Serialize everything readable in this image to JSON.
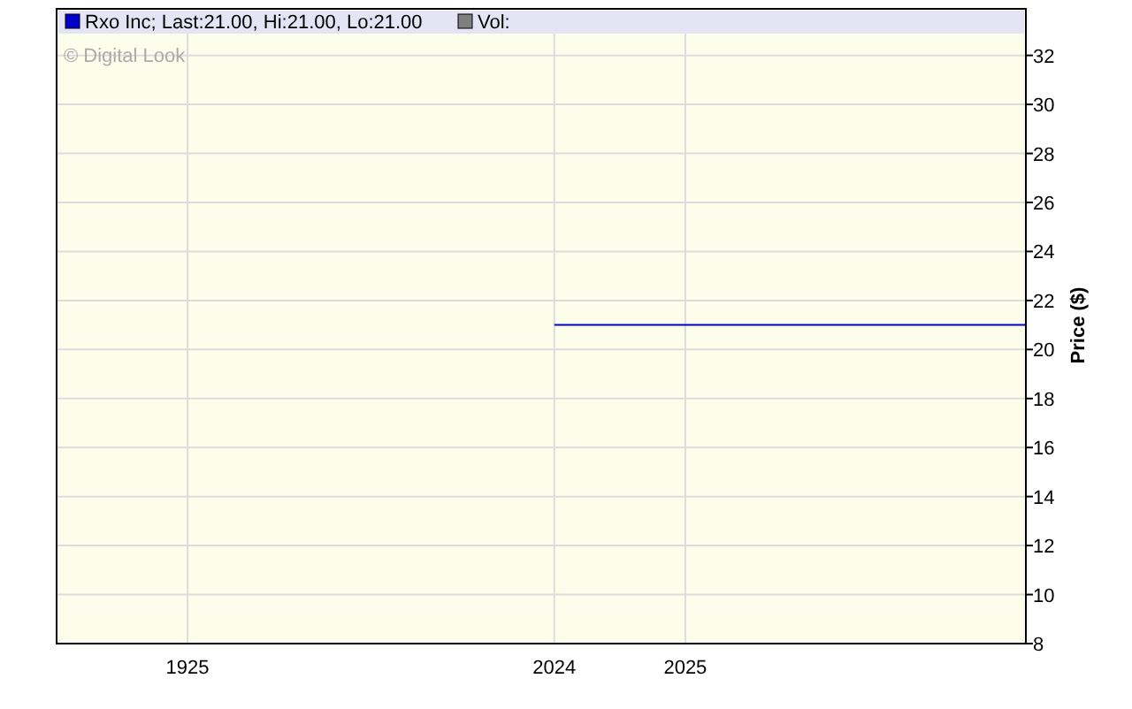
{
  "chart": {
    "legend": [
      {
        "label": "Rxo Inc; Last:21.00, Hi:21.00, Lo:21.00",
        "color": "#0000cc"
      },
      {
        "label": "Vol:",
        "color": "#808080"
      }
    ],
    "credit": "© Digital Look",
    "chart_data": {
      "type": "line",
      "ylabel": "Price ($)",
      "ylim": [
        8,
        33.9
      ],
      "grid": true,
      "categories": [
        null,
        null,
        null,
        null,
        null,
        "1925",
        null,
        null,
        null,
        null,
        null,
        null,
        null,
        null,
        null,
        null,
        null,
        null,
        null,
        "2024",
        null,
        null,
        null,
        null,
        "2025",
        null,
        null,
        null,
        null,
        null,
        null,
        null,
        null,
        null,
        null,
        null,
        null,
        null
      ],
      "series": [
        {
          "color": "#0000cc",
          "values": [
            null,
            null,
            null,
            null,
            null,
            null,
            null,
            null,
            null,
            null,
            null,
            null,
            null,
            null,
            null,
            null,
            null,
            null,
            null,
            21,
            21,
            21,
            21,
            21,
            21,
            21,
            21,
            21,
            21,
            21,
            21,
            21,
            21,
            21,
            21,
            21,
            21,
            21
          ]
        }
      ],
      "yticks": [
        {
          "value": 8,
          "label": "8"
        },
        {
          "value": 10,
          "label": "10"
        },
        {
          "value": 12,
          "label": "12"
        },
        {
          "value": 14,
          "label": "14"
        },
        {
          "value": 16,
          "label": "16"
        },
        {
          "value": 18,
          "label": "18"
        },
        {
          "value": 20,
          "label": "20"
        },
        {
          "value": 22,
          "label": "22"
        },
        {
          "value": 24,
          "label": "24"
        },
        {
          "value": 26,
          "label": "26"
        },
        {
          "value": 28,
          "label": "28"
        },
        {
          "value": 30,
          "label": "30"
        },
        {
          "value": 32,
          "label": "32"
        }
      ]
    }
  }
}
